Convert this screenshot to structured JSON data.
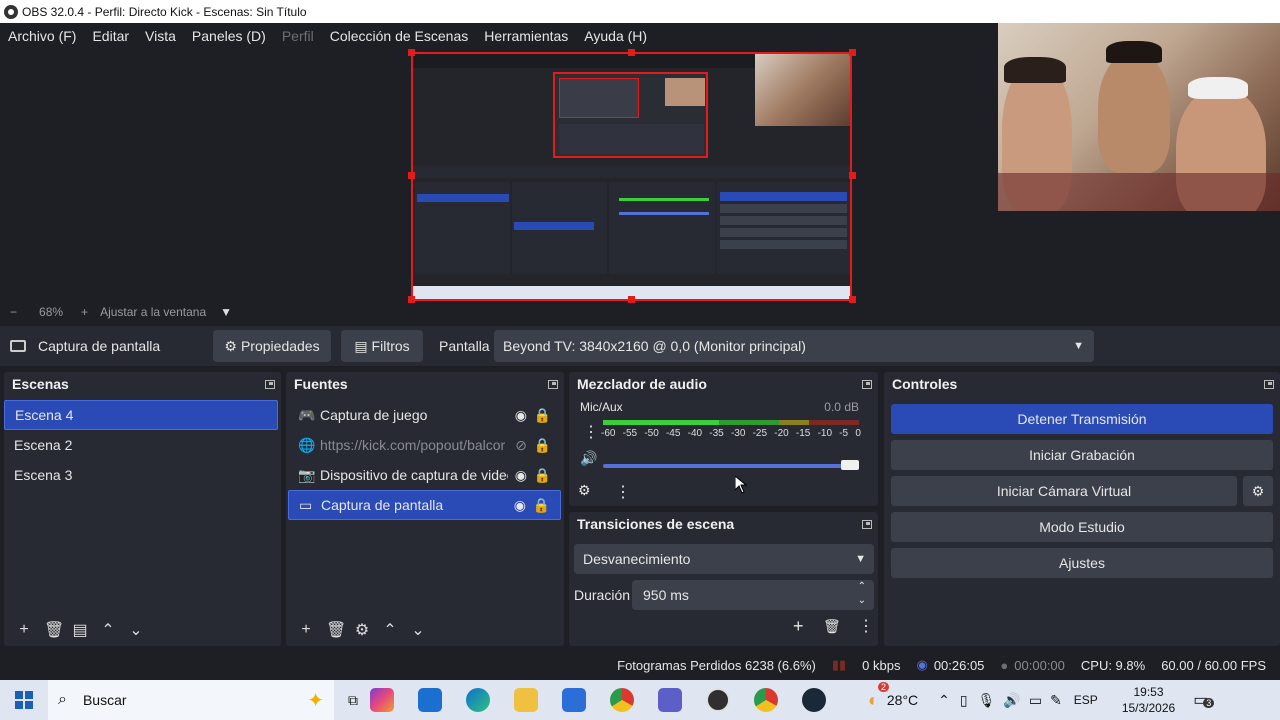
{
  "window": {
    "title": "OBS 32.0.4 - Perfil: Directo Kick - Escenas: Sin Título"
  },
  "menu": {
    "items": [
      "Archivo (F)",
      "Editar",
      "Vista",
      "Paneles (D)",
      "Perfil",
      "Colección de Escenas",
      "Herramientas",
      "Ayuda (H)"
    ]
  },
  "zoom": {
    "minus": "−",
    "value": "68%",
    "plus": "+",
    "fit_label": "Ajustar a la ventana"
  },
  "source_toolbar": {
    "source_name": "Captura de pantalla",
    "properties_label": "Propiedades",
    "filters_label": "Filtros",
    "display_label": "Pantalla",
    "display_value": "Beyond TV: 3840x2160 @ 0,0 (Monitor principal)"
  },
  "scenes": {
    "title": "Escenas",
    "items": [
      "Escena 4",
      "Escena 2",
      "Escena 3"
    ],
    "selected": "Escena 4"
  },
  "sources": {
    "title": "Fuentes",
    "items": [
      {
        "label": "Captura de juego",
        "icon": "gamepad-icon"
      },
      {
        "label": "https://kick.com/popout/balcor",
        "icon": "globe-icon"
      },
      {
        "label": "Dispositivo de captura de video",
        "icon": "camera-icon"
      },
      {
        "label": "Captura de pantalla",
        "icon": "monitor-icon"
      }
    ],
    "selected": "Captura de pantalla"
  },
  "mixer": {
    "title": "Mezclador de audio",
    "channel": "Mic/Aux",
    "level": "0.0 dB",
    "ticks": [
      "-60",
      "-55",
      "-50",
      "-45",
      "-40",
      "-35",
      "-30",
      "-25",
      "-20",
      "-15",
      "-10",
      "-5",
      "0"
    ],
    "volume_fraction": 0.97
  },
  "transitions": {
    "title": "Transiciones de escena",
    "selected": "Desvanecimiento",
    "duration_label": "Duración",
    "duration_value": "950 ms"
  },
  "controls": {
    "title": "Controles",
    "stop_stream": "Detener Transmisión",
    "start_recording": "Iniciar Grabación",
    "start_virtual_cam": "Iniciar Cámara Virtual",
    "studio_mode": "Modo Estudio",
    "settings": "Ajustes"
  },
  "status": {
    "dropped_frames": "Fotogramas Perdidos 6238 (6.6%)",
    "bitrate": "0 kbps",
    "stream_time": "00:26:05",
    "record_time": "00:00:00",
    "cpu": "CPU: 9.8%",
    "fps": "60.00 / 60.00 FPS"
  },
  "taskbar": {
    "search_placeholder": "Buscar",
    "temperature": "28°C",
    "language": "ESP",
    "time": "19:53",
    "date": "15/3/2026",
    "notification_count": "3",
    "weather_badge": "2"
  },
  "colors": {
    "accent": "#2a4bb6",
    "bg": "#1e1f24",
    "dock": "#272a33",
    "red": "#e31b1b",
    "meter_green": "#3ccf3c",
    "meter_yellow": "#d6c324",
    "meter_red": "#d63a2a"
  }
}
